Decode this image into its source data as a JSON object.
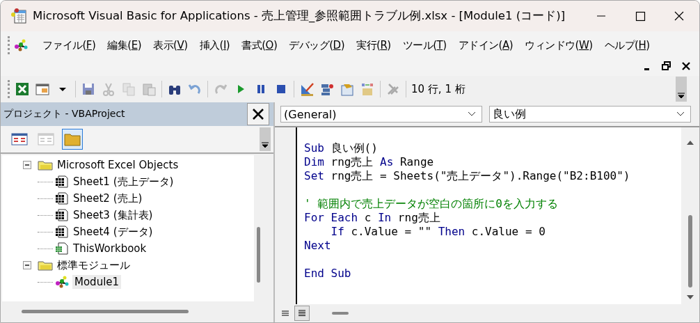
{
  "window": {
    "title": "Microsoft Visual Basic for Applications - 売上管理_参照範囲トラブル例.xlsx - [Module1 (コード)]"
  },
  "menu": [
    {
      "before": "ファイル(",
      "key": "F",
      "after": ")"
    },
    {
      "before": "編集(",
      "key": "E",
      "after": ")"
    },
    {
      "before": "表示(",
      "key": "V",
      "after": ")"
    },
    {
      "before": "挿入(",
      "key": "I",
      "after": ")"
    },
    {
      "before": "書式(",
      "key": "O",
      "after": ")"
    },
    {
      "before": "デバッグ(",
      "key": "D",
      "after": ")"
    },
    {
      "before": "実行(",
      "key": "R",
      "after": ")"
    },
    {
      "before": "ツール(",
      "key": "T",
      "after": ")"
    },
    {
      "before": "アドイン(",
      "key": "A",
      "after": ")"
    },
    {
      "before": "ウィンドウ(",
      "key": "W",
      "after": ")"
    },
    {
      "before": "ヘルプ(",
      "key": "H",
      "after": ")"
    }
  ],
  "toolbar": {
    "buttons": [
      {
        "kind": "button",
        "disabled": false
      },
      {
        "kind": "button",
        "disabled": false
      },
      {
        "kind": "button",
        "disabled": false
      },
      {
        "kind": "separator"
      },
      {
        "kind": "button",
        "disabled": true
      },
      {
        "kind": "button",
        "disabled": true
      },
      {
        "kind": "button",
        "disabled": true
      },
      {
        "kind": "button",
        "disabled": false
      },
      {
        "kind": "separator"
      },
      {
        "kind": "button",
        "disabled": false
      },
      {
        "kind": "button",
        "disabled": true
      },
      {
        "kind": "separator"
      },
      {
        "kind": "button",
        "disabled": false
      },
      {
        "kind": "button",
        "disabled": false
      },
      {
        "kind": "button",
        "disabled": false
      },
      {
        "kind": "button",
        "disabled": false
      },
      {
        "kind": "separator"
      },
      {
        "kind": "button",
        "disabled": false
      },
      {
        "kind": "button",
        "disabled": false
      },
      {
        "kind": "button",
        "disabled": false
      },
      {
        "kind": "button",
        "disabled": true
      },
      {
        "kind": "separator"
      },
      {
        "kind": "button",
        "disabled": false
      }
    ],
    "position": "10 行, 1 桁"
  },
  "project": {
    "title": "プロジェクト - VBAProject",
    "tools": [
      {
        "disabled": false,
        "selected": false
      },
      {
        "disabled": true,
        "selected": false
      },
      {
        "disabled": false,
        "selected": true
      }
    ],
    "tree": [
      {
        "label": "Microsoft Excel Objects",
        "kind": "folder",
        "expanded": true,
        "selected": false,
        "children": [
          {
            "label": "Sheet1 (売上データ)",
            "kind": "sheet",
            "selected": false
          },
          {
            "label": "Sheet2 (売上)",
            "kind": "sheet",
            "selected": false
          },
          {
            "label": "Sheet3 (集計表)",
            "kind": "sheet",
            "selected": false
          },
          {
            "label": "Sheet4 (データ)",
            "kind": "sheet",
            "selected": false
          },
          {
            "label": "ThisWorkbook",
            "kind": "workbook",
            "selected": false
          }
        ]
      },
      {
        "label": "標準モジュール",
        "kind": "folder",
        "expanded": true,
        "selected": false,
        "children": [
          {
            "label": "Module1",
            "kind": "module",
            "selected": true
          }
        ]
      }
    ]
  },
  "code": {
    "object": "(General)",
    "procedure": "良い例",
    "lines": [
      {
        "kind": "code",
        "segments": [
          {
            "kind": "keyword",
            "text": "Sub"
          },
          {
            "kind": "plain",
            "text": " 良い例()"
          }
        ]
      },
      {
        "kind": "code",
        "segments": [
          {
            "kind": "keyword",
            "text": "Dim"
          },
          {
            "kind": "plain",
            "text": " rng売上 "
          },
          {
            "kind": "keyword",
            "text": "As"
          },
          {
            "kind": "plain",
            "text": " Range"
          }
        ]
      },
      {
        "kind": "code",
        "segments": [
          {
            "kind": "keyword",
            "text": "Set"
          },
          {
            "kind": "plain",
            "text": " rng売上 = Sheets(\"売上データ\").Range(\"B2:B100\")"
          }
        ]
      },
      {
        "kind": "blank"
      },
      {
        "kind": "code",
        "segments": [
          {
            "kind": "comment",
            "text": "' 範囲内で売上データが空白の箇所に0を入力する"
          }
        ]
      },
      {
        "kind": "code",
        "segments": [
          {
            "kind": "keyword",
            "text": "For Each"
          },
          {
            "kind": "plain",
            "text": " c "
          },
          {
            "kind": "keyword",
            "text": "In"
          },
          {
            "kind": "plain",
            "text": " rng売上"
          }
        ]
      },
      {
        "kind": "code",
        "indent": true,
        "segments": [
          {
            "kind": "keyword",
            "text": "If"
          },
          {
            "kind": "plain",
            "text": " c.Value = \"\" "
          },
          {
            "kind": "keyword",
            "text": "Then"
          },
          {
            "kind": "plain",
            "text": " c.Value = 0"
          }
        ]
      },
      {
        "kind": "code",
        "segments": [
          {
            "kind": "keyword",
            "text": "Next"
          }
        ]
      },
      {
        "kind": "blank"
      },
      {
        "kind": "code",
        "segments": [
          {
            "kind": "keyword",
            "text": "End Sub"
          }
        ]
      }
    ],
    "views": [
      {
        "selected": false
      },
      {
        "selected": true
      }
    ]
  }
}
